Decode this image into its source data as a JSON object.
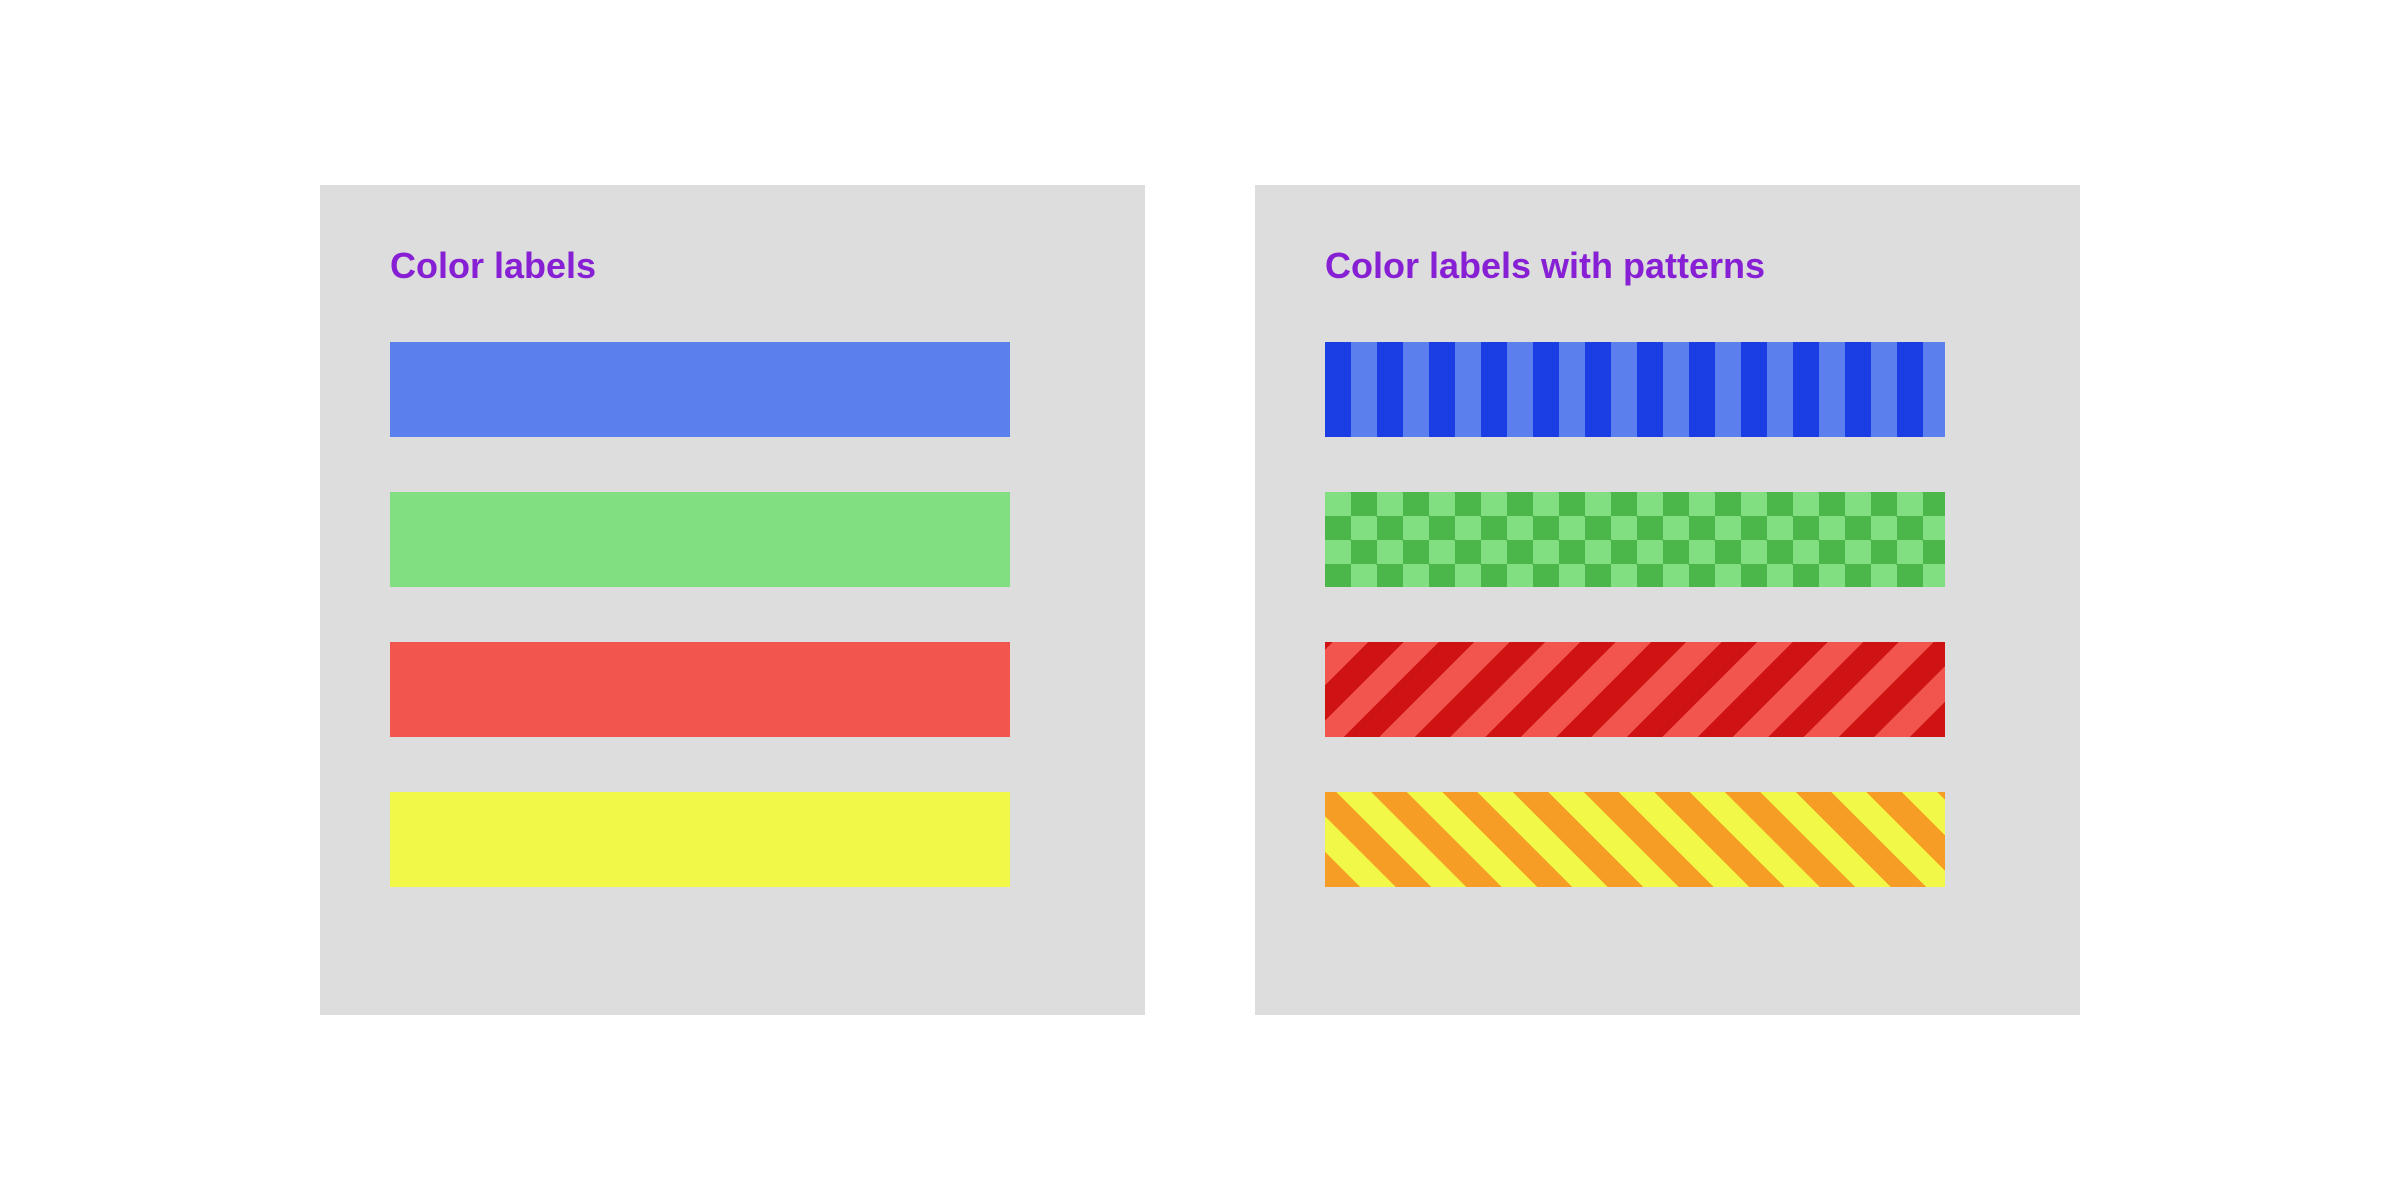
{
  "panels": {
    "left": {
      "title": "Color labels",
      "swatches": [
        {
          "name": "blue",
          "color": "#5b80ee"
        },
        {
          "name": "green",
          "color": "#82df81"
        },
        {
          "name": "red",
          "color": "#f2554e"
        },
        {
          "name": "yellow",
          "color": "#f1f848"
        }
      ]
    },
    "right": {
      "title": "Color labels with patterns",
      "swatches": [
        {
          "name": "blue",
          "pattern": "vertical-stripes",
          "color_base": "#5b80ee",
          "color_stripe": "#1b3de4"
        },
        {
          "name": "green",
          "pattern": "checkerboard",
          "color_base": "#82df81",
          "color_check": "#4bb649"
        },
        {
          "name": "red",
          "pattern": "diagonal-stripes-left",
          "color_base": "#f2554e",
          "color_stripe": "#cf1313"
        },
        {
          "name": "yellow",
          "pattern": "diagonal-stripes-right",
          "color_base": "#f1f848",
          "color_stripe": "#f59d24"
        }
      ]
    }
  }
}
